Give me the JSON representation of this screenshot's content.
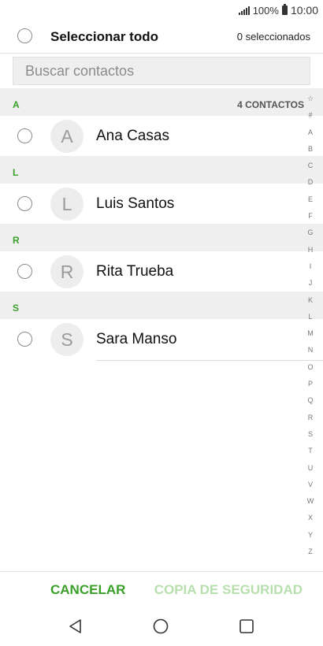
{
  "status_bar": {
    "battery": "100%",
    "time": "10:00",
    "icons": [
      "signal-icon",
      "battery-icon"
    ]
  },
  "header": {
    "select_all_label": "Seleccionar todo",
    "selected_count": "0 seleccionados"
  },
  "search": {
    "placeholder": "Buscar contactos",
    "value": ""
  },
  "sections": [
    {
      "letter": "A",
      "count_label": "4 CONTACTOS",
      "contacts": [
        {
          "initial": "A",
          "name": "Ana Casas"
        }
      ]
    },
    {
      "letter": "L",
      "count_label": "",
      "contacts": [
        {
          "initial": "L",
          "name": "Luis Santos"
        }
      ]
    },
    {
      "letter": "R",
      "count_label": "",
      "contacts": [
        {
          "initial": "R",
          "name": "Rita Trueba"
        }
      ]
    },
    {
      "letter": "S",
      "count_label": "",
      "contacts": [
        {
          "initial": "S",
          "name": "Sara Manso"
        }
      ]
    }
  ],
  "index_bar": [
    "☆",
    "#",
    "A",
    "B",
    "C",
    "D",
    "E",
    "F",
    "G",
    "H",
    "I",
    "J",
    "K",
    "L",
    "M",
    "N",
    "O",
    "P",
    "Q",
    "R",
    "S",
    "T",
    "U",
    "V",
    "W",
    "X",
    "Y",
    "Z"
  ],
  "actions": {
    "cancel": "CANCELAR",
    "backup": "COPIA DE SEGURIDAD"
  },
  "nav": [
    "back-icon",
    "home-icon",
    "recent-apps-icon"
  ],
  "colors": {
    "accent": "#3aa02a",
    "accent_disabled": "#b7dfae",
    "section_bg": "#efefef"
  }
}
